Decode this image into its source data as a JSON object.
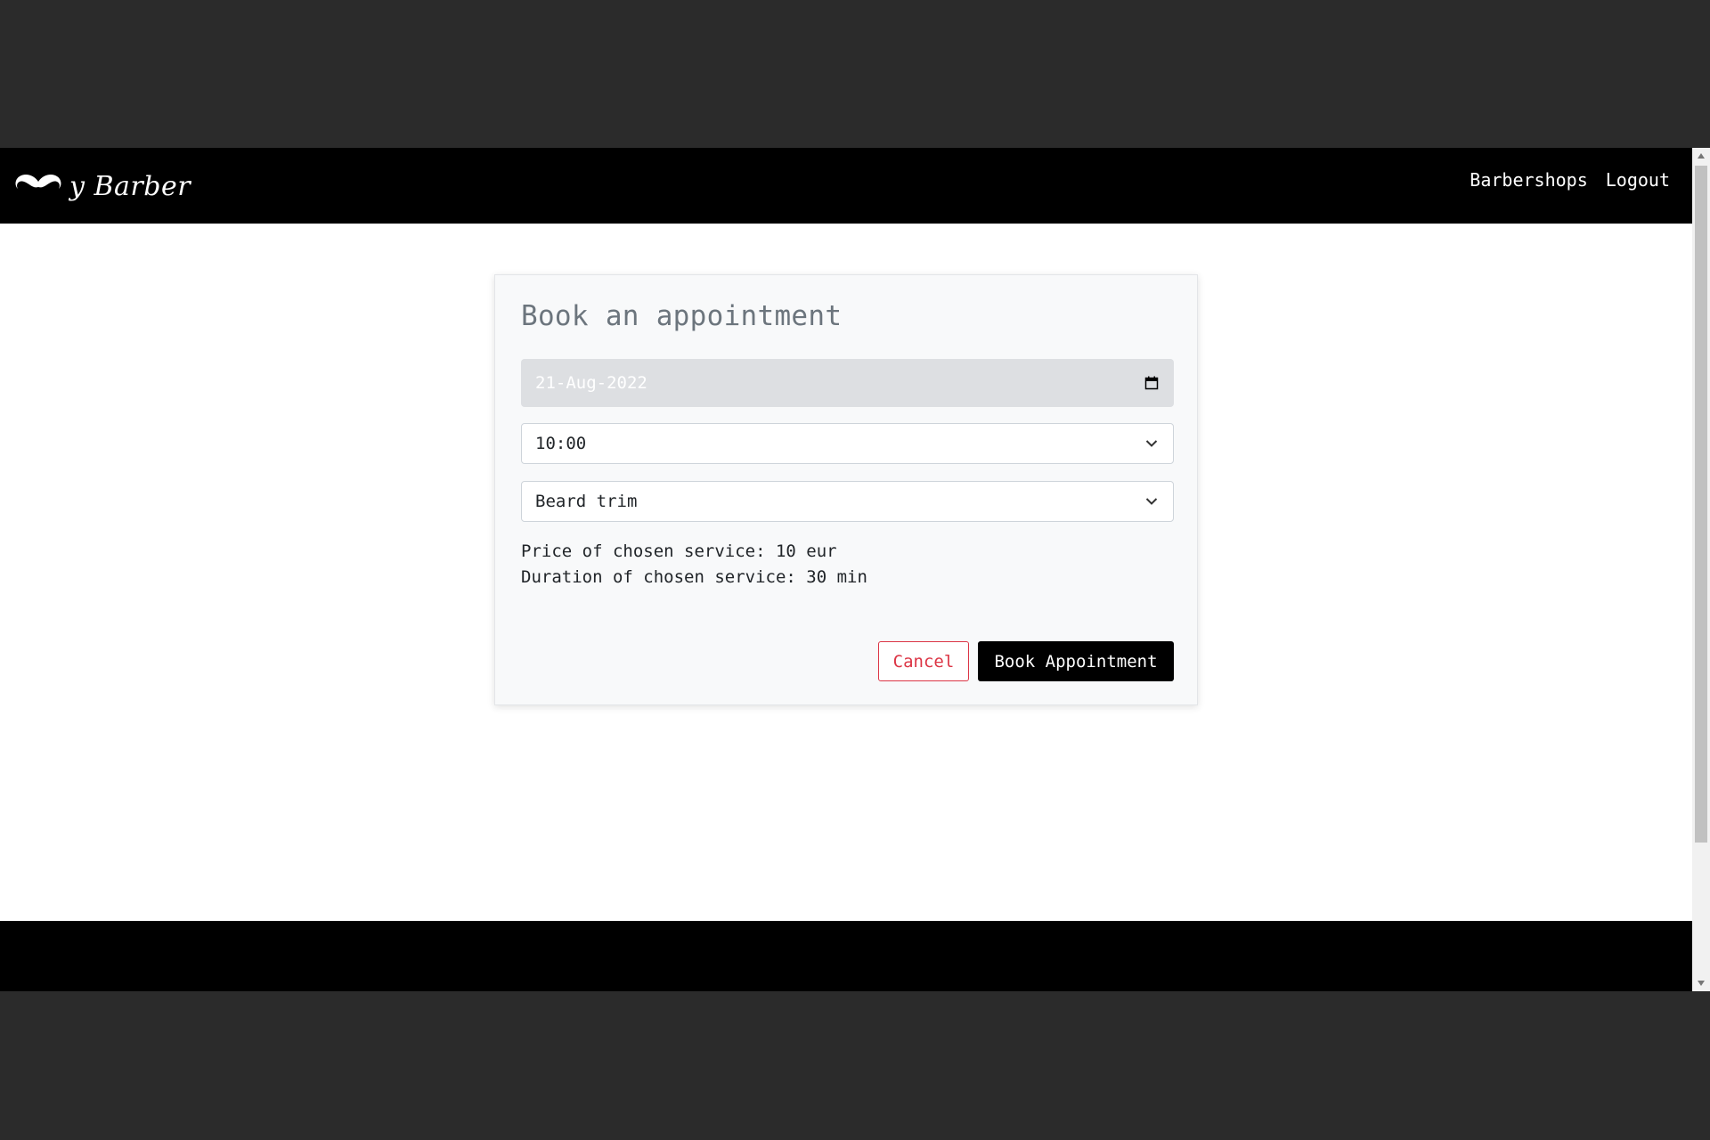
{
  "navbar": {
    "brand_text": "y Barber",
    "brand_icon": "mustache-icon",
    "links": [
      "Barbershops",
      "Logout"
    ]
  },
  "form": {
    "title": "Book an appointment",
    "date_value": "21-Aug-2022",
    "date_icon": "calendar-icon",
    "time_value": "10:00",
    "service_value": "Beard trim",
    "select_icon": "chevron-down-icon",
    "price_line": "Price of chosen service: 10 eur",
    "duration_line": "Duration of chosen service: 30 min",
    "cancel_label": "Cancel",
    "book_label": "Book Appointment"
  },
  "colors": {
    "navbar_bg": "#000000",
    "page_bg": "#2b2b2b",
    "cancel": "#dc3545",
    "title": "#6c757d"
  }
}
